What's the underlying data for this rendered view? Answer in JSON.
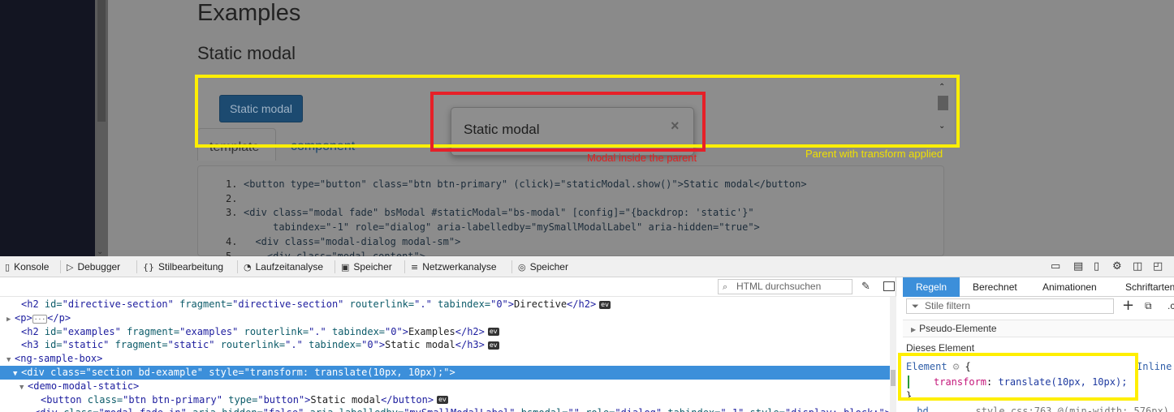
{
  "page": {
    "heading_examples": "Examples",
    "heading_static": "Static modal",
    "button_label": "Static modal",
    "modal_title": "Static modal",
    "modal_close": "×",
    "tabs": {
      "template": "template",
      "component": "component"
    },
    "code_lines": [
      {
        "num": "1.",
        "text": "<button type=\"button\" class=\"btn btn-primary\" (click)=\"staticModal.show()\">Static modal</button>"
      },
      {
        "num": "2.",
        "text": ""
      },
      {
        "num": "3.",
        "text": "<div class=\"modal fade\" bsModal #staticModal=\"bs-modal\" [config]=\"{backdrop: 'static'}\""
      },
      {
        "num": "",
        "text": "     tabindex=\"-1\" role=\"dialog\" aria-labelledby=\"mySmallModalLabel\" aria-hidden=\"true\">"
      },
      {
        "num": "4.",
        "text": "  <div class=\"modal-dialog modal-sm\">"
      },
      {
        "num": "5.",
        "text": "    <div class=\"modal-content\">"
      }
    ]
  },
  "annotations": {
    "red_note": "Modal inside the parent",
    "yellow_note": "Parent with transform applied",
    "colors": {
      "yellow": "#ffef00",
      "red": "#e62028"
    }
  },
  "devtools": {
    "tabs": [
      {
        "icon": "console-icon",
        "glyph": "▯",
        "label": "Konsole"
      },
      {
        "icon": "debugger-icon",
        "glyph": "▷",
        "label": "Debugger"
      },
      {
        "icon": "style-editor-icon",
        "glyph": "{}",
        "label": "Stilbearbeitung"
      },
      {
        "icon": "performance-icon",
        "glyph": "◔",
        "label": "Laufzeitanalyse"
      },
      {
        "icon": "memory-icon",
        "glyph": "▣",
        "label": "Speicher"
      },
      {
        "icon": "network-icon",
        "glyph": "≡",
        "label": "Netzwerkanalyse"
      },
      {
        "icon": "storage-icon",
        "glyph": "◎",
        "label": "Speicher"
      }
    ],
    "search_placeholder": "HTML durchsuchen",
    "tree": [
      {
        "indent": 2,
        "tw": "",
        "html": [
          [
            "tag",
            "<h2 "
          ],
          [
            "an",
            "id="
          ],
          [
            "av",
            "\"directive-section\""
          ],
          [
            "txt",
            " "
          ],
          [
            "an",
            "fragment="
          ],
          [
            "av",
            "\"directive-section\""
          ],
          [
            "txt",
            " "
          ],
          [
            "an",
            "routerlink="
          ],
          [
            "av",
            "\".\""
          ],
          [
            "txt",
            " "
          ],
          [
            "an",
            "tabindex="
          ],
          [
            "av",
            "\"0\""
          ],
          [
            "tag",
            ">"
          ],
          [
            "txt",
            "Directive"
          ],
          [
            "tag",
            "</h2>"
          ]
        ],
        "ev": true
      },
      {
        "indent": 1,
        "tw": "▶",
        "html": [
          [
            "tag",
            "<p>"
          ],
          [
            "dots",
            "···"
          ],
          [
            "tag",
            "</p>"
          ]
        ],
        "ev": false
      },
      {
        "indent": 2,
        "tw": "",
        "html": [
          [
            "tag",
            "<h2 "
          ],
          [
            "an",
            "id="
          ],
          [
            "av",
            "\"examples\""
          ],
          [
            "txt",
            " "
          ],
          [
            "an",
            "fragment="
          ],
          [
            "av",
            "\"examples\""
          ],
          [
            "txt",
            " "
          ],
          [
            "an",
            "routerlink="
          ],
          [
            "av",
            "\".\""
          ],
          [
            "txt",
            " "
          ],
          [
            "an",
            "tabindex="
          ],
          [
            "av",
            "\"0\""
          ],
          [
            "tag",
            ">"
          ],
          [
            "txt",
            "Examples"
          ],
          [
            "tag",
            "</h2>"
          ]
        ],
        "ev": true
      },
      {
        "indent": 2,
        "tw": "",
        "html": [
          [
            "tag",
            "<h3 "
          ],
          [
            "an",
            "id="
          ],
          [
            "av",
            "\"static\""
          ],
          [
            "txt",
            " "
          ],
          [
            "an",
            "fragment="
          ],
          [
            "av",
            "\"static\""
          ],
          [
            "txt",
            " "
          ],
          [
            "an",
            "routerlink="
          ],
          [
            "av",
            "\".\""
          ],
          [
            "txt",
            " "
          ],
          [
            "an",
            "tabindex="
          ],
          [
            "av",
            "\"0\""
          ],
          [
            "tag",
            ">"
          ],
          [
            "txt",
            "Static modal"
          ],
          [
            "tag",
            "</h3>"
          ]
        ],
        "ev": true
      },
      {
        "indent": 1,
        "tw": "▼",
        "html": [
          [
            "tag",
            "<ng-sample-box>"
          ]
        ],
        "ev": false
      },
      {
        "indent": 2,
        "tw": "▼",
        "selected": true,
        "html": [
          [
            "tag",
            "<div "
          ],
          [
            "an",
            "class="
          ],
          [
            "av",
            "\"section bd-example\""
          ],
          [
            "txt",
            " "
          ],
          [
            "an",
            "style="
          ],
          [
            "av",
            "\"transform: translate(10px, 10px);\""
          ],
          [
            "tag",
            ">"
          ]
        ],
        "ev": false
      },
      {
        "indent": 3,
        "tw": "▼",
        "html": [
          [
            "tag",
            "<demo-modal-static>"
          ]
        ],
        "ev": false
      },
      {
        "indent": 5,
        "tw": "",
        "html": [
          [
            "tag",
            "<button "
          ],
          [
            "an",
            "class="
          ],
          [
            "av",
            "\"btn btn-primary\""
          ],
          [
            "txt",
            " "
          ],
          [
            "an",
            "type="
          ],
          [
            "av",
            "\"button\""
          ],
          [
            "tag",
            ">"
          ],
          [
            "txt",
            "Static modal"
          ],
          [
            "tag",
            "</button>"
          ]
        ],
        "ev": true
      },
      {
        "indent": 4,
        "tw": "▶",
        "html": [
          [
            "tag",
            "<div "
          ],
          [
            "an",
            "class="
          ],
          [
            "av",
            "\"modal fade in\""
          ],
          [
            "txt",
            " "
          ],
          [
            "an",
            "aria-hidden="
          ],
          [
            "av",
            "\"false\""
          ],
          [
            "txt",
            " "
          ],
          [
            "an",
            "aria-labelledby="
          ],
          [
            "av",
            "\"mySmallModalLabel\""
          ],
          [
            "txt",
            " "
          ],
          [
            "an",
            "bsmodal="
          ],
          [
            "av",
            "\"\""
          ],
          [
            "txt",
            " "
          ],
          [
            "an",
            "role="
          ],
          [
            "av",
            "\"dialog\""
          ],
          [
            "txt",
            " "
          ],
          [
            "an",
            "tabindex="
          ],
          [
            "av",
            "\"-1\""
          ],
          [
            "txt",
            " "
          ],
          [
            "an",
            "style="
          ],
          [
            "av",
            "\"display: block;\""
          ],
          [
            "tag",
            ">"
          ]
        ],
        "ev": false
      }
    ],
    "ev_label": "ev"
  },
  "rules": {
    "tabs": [
      "Regeln",
      "Berechnet",
      "Animationen",
      "Schriftarten"
    ],
    "filter_placeholder": "Stile filtern",
    "add_rule": "+",
    "pseudo": "Pseudo-Elemente",
    "this_element": "Dieses Element",
    "element_selector": "Element",
    "open_brace": "{",
    "inline": "Inline",
    "prop": "transform",
    "value": "translate(10px, 10px);",
    "close_brace": "}",
    "next_selector": ".bd",
    "next_source": "style.css:763 @(min-width: 576px)"
  }
}
